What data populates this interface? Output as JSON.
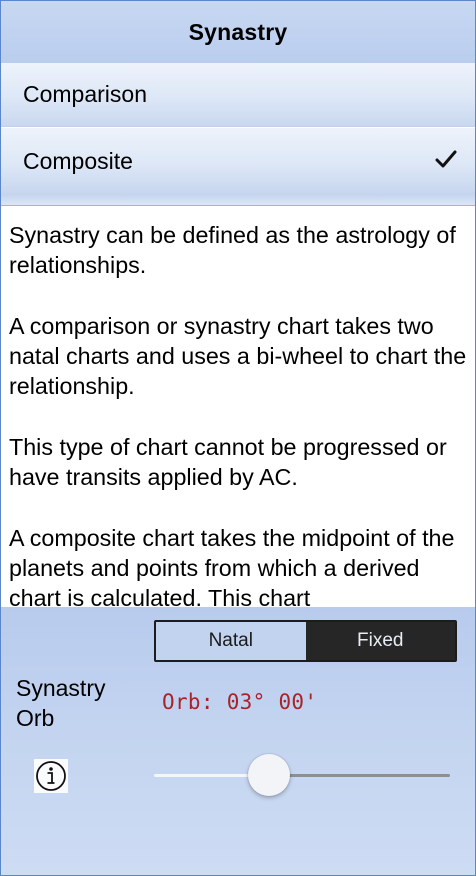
{
  "header": {
    "title": "Synastry"
  },
  "options": [
    {
      "label": "Comparison",
      "selected": false
    },
    {
      "label": "Composite",
      "selected": true
    }
  ],
  "description": {
    "paragraphs": [
      "Synastry can be defined as the astrology of relationships.",
      "A comparison or synastry chart takes two natal charts and uses a bi-wheel to chart the relationship.",
      "This type of chart cannot be progressed or have transits applied by AC.",
      "A composite chart takes the midpoint of the planets and points from which a derived chart is calculated. This chart"
    ]
  },
  "orb_panel": {
    "segments": [
      {
        "label": "Natal",
        "selected": false
      },
      {
        "label": "Fixed",
        "selected": true
      }
    ],
    "label_line1": "Synastry",
    "label_line2": "Orb",
    "value": "Orb: 03° 00'",
    "slider_fraction": 0.39,
    "info_icon": "info-circle-icon"
  },
  "colors": {
    "header_bg": "#c2d3f0",
    "orb_value": "#a8232a",
    "segment_selected": "#262626"
  }
}
